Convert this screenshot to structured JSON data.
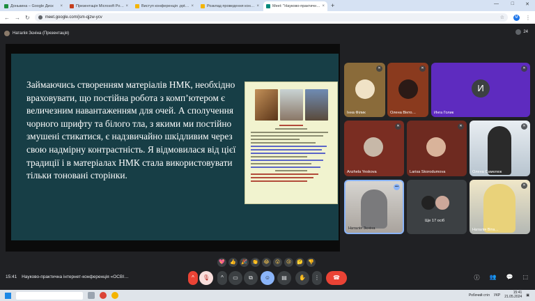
{
  "browser": {
    "tabs": [
      {
        "title": "Донькина – Google Диск",
        "color": "#1e8e3e",
        "active": false
      },
      {
        "title": "Презентація Microsoft PowerPoint",
        "color": "#c43e1c",
        "active": false
      },
      {
        "title": "Виступ конференція .pptx – Goo",
        "color": "#f4b400",
        "active": false
      },
      {
        "title": "Розклад проведення конфере",
        "color": "#f4b400",
        "active": false
      },
      {
        "title": "Meet: \"Науково-практична інте",
        "color": "#00897b",
        "active": true
      }
    ],
    "new_tab": "+",
    "url": "meet.google.com/jsm-qjzw-ycv",
    "profile_initial": "М"
  },
  "meet": {
    "presenter_label": "Наталія Зєніна (Презентація)",
    "participant_count": "24",
    "slide": {
      "text": "Займаючись створенням матеріалів НМК, необхідно враховувати, що постійна робота з комп’ютером є величезним навантаженням для очей. А сполучення чорного шрифту та білого тла, з якими ми постійно змушені стикатися,  є надзвичайно шкідливим через свою надмірну контрастність. Я відмовилася від цієї традиції і в матеріалах НМК стала використовувати тільки тоновані сторінки."
    },
    "tiles": [
      {
        "name": "Інна Філик",
        "muted": true
      },
      {
        "name": "Олена Вікто…",
        "muted": true
      },
      {
        "name": "Инга Голик",
        "muted": true,
        "initial": "И"
      },
      {
        "name": "Anzhela Yeskova",
        "muted": true
      },
      {
        "name": "Larisa Skorodumova",
        "muted": true
      },
      {
        "name": "Олена Самелюк",
        "muted": true
      },
      {
        "name": "Наталія Зєніна",
        "muted": false
      },
      {
        "name": "Ще 17 осіб",
        "muted": false
      },
      {
        "name": "Наталія Віта…",
        "muted": true
      }
    ],
    "emoji_reactions": [
      "💖",
      "👍",
      "🎉",
      "👏",
      "😂",
      "😮",
      "😢",
      "🤔",
      "👎"
    ],
    "clock": "15:41",
    "meeting_title": "Науково-практична інтернет-конференція «ОСВІ…"
  },
  "taskbar": {
    "search_placeholder": "",
    "weather": "Робочий стіл",
    "lang": "УКР",
    "time": "15:41",
    "date": "21.05.2024"
  },
  "colors": {
    "slide_bg": "#173e46",
    "doc_bg": "#f1f3cf",
    "end_call": "#ea4335",
    "meet_bg": "#202124"
  }
}
